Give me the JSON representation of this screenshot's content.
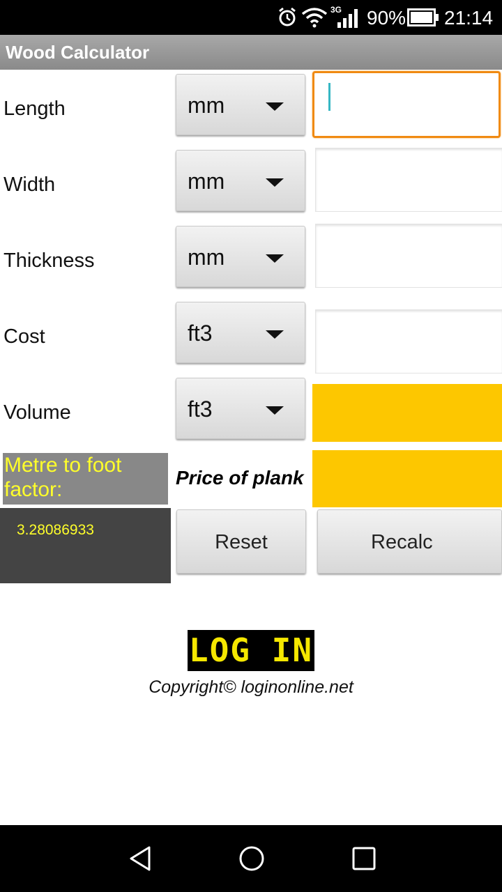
{
  "status_bar": {
    "network": "3G",
    "battery": "90%",
    "time": "21:14",
    "icons": [
      "alarm-icon",
      "wifi-icon",
      "signal-icon",
      "battery-icon"
    ]
  },
  "app": {
    "title": "Wood Calculator"
  },
  "rows": [
    {
      "label": "Length",
      "unit": "mm",
      "value": ""
    },
    {
      "label": "Width",
      "unit": "mm",
      "value": ""
    },
    {
      "label": "Thickness",
      "unit": "mm",
      "value": ""
    },
    {
      "label": "Cost",
      "unit": "ft3",
      "value": ""
    },
    {
      "label": "Volume",
      "unit": "ft3",
      "value": ""
    }
  ],
  "factor": {
    "label": "Metre to foot factor:",
    "value": "3.28086933"
  },
  "price": {
    "label": "Price of plank",
    "value": ""
  },
  "buttons": {
    "reset": "Reset",
    "recalc": "Recalc"
  },
  "footer": {
    "logo_text": "LOG IN",
    "copyright": "Copyright© loginonline.net"
  },
  "colors": {
    "accent_focus": "#f08a12",
    "result_yellow": "#fdc700",
    "factor_text": "#ffff2a"
  },
  "nav": [
    "back-icon",
    "home-icon",
    "recents-icon"
  ]
}
